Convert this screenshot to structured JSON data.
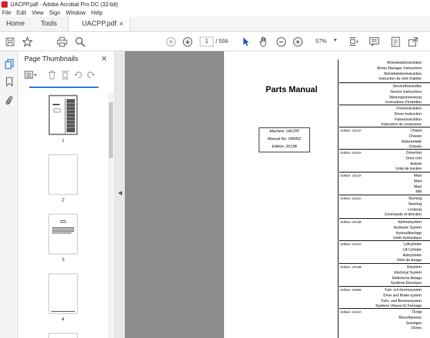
{
  "window": {
    "title": "UACPP.pdf - Adobe Acrobat Pro DC (32-bit)"
  },
  "menu": [
    "File",
    "Edit",
    "View",
    "Sign",
    "Window",
    "Help"
  ],
  "tabs": {
    "home": "Home",
    "tools": "Tools",
    "document": "UACPP.pdf"
  },
  "toolbar": {
    "current_page": "1",
    "page_total": "/ 556",
    "zoom": "57%"
  },
  "thumbnails": {
    "title": "Page Thumbnails",
    "pages": [
      "1",
      "2",
      "3",
      "4"
    ]
  },
  "document": {
    "title": "Parts Manual",
    "machine": "Machine: UACPP",
    "manual_no": "Manual No: 008952",
    "edition": "Edition: 2013B",
    "sections": [
      {
        "edition": "",
        "lines": [
          "Arbetsledarinstruktion",
          "Works Manager Instructions",
          "Betriebsleiterinstruktion",
          "Instruction de chef d'atelier"
        ]
      },
      {
        "edition": "",
        "lines": [
          "Serviceföreskrifter",
          "Service Instructions",
          "Wartungsanweisung",
          "Instructions d'entretien"
        ]
      },
      {
        "edition": "",
        "lines": [
          "Förarinstruktion",
          "Driver Instruction",
          "Fahrerinstruktion",
          "Instruction de conducteur"
        ]
      },
      {
        "edition": "Edition: 2013A",
        "lines": [
          "Chassi",
          "Chassis",
          "Rahmenteile",
          "Châssis"
        ]
      },
      {
        "edition": "Edition: 2013A",
        "lines": [
          "Drivenhet",
          "Drive Unit",
          "Antrieb",
          "Unité de traction"
        ]
      },
      {
        "edition": "Edition: 2013A",
        "lines": [
          "Mast",
          "Mast",
          "Mast",
          "Mât"
        ]
      },
      {
        "edition": "Edition: 2013A",
        "lines": [
          "Styrning",
          "Steering",
          "Lenkung",
          "Commande et direction"
        ]
      },
      {
        "edition": "Edition: 2013B",
        "lines": [
          "Hydraulsystem",
          "Hydraulic System",
          "Hydraulikanlage",
          "Unité Hydraulique"
        ]
      },
      {
        "edition": "Edition: 2013A",
        "lines": [
          "Lyftcylinder",
          "Lift Cylinder",
          "Hubzylinder",
          "Vérin de levage"
        ]
      },
      {
        "edition": "Edition: 2013B",
        "lines": [
          "Elsystem",
          "Electrical System",
          "Elektrische Anlage",
          "Système Électrique"
        ]
      },
      {
        "edition": "Edition: 2009B",
        "lines": [
          "Fart- och bromssystem",
          "Drive and Brake system",
          "Fahr- und Bremsesystem",
          "Système Vitesse Et Freinage"
        ]
      },
      {
        "edition": "Edition: 2013A",
        "lines": [
          "Övrigt",
          "Miscellaneous",
          "Sonstiges",
          "Divers"
        ]
      }
    ]
  }
}
